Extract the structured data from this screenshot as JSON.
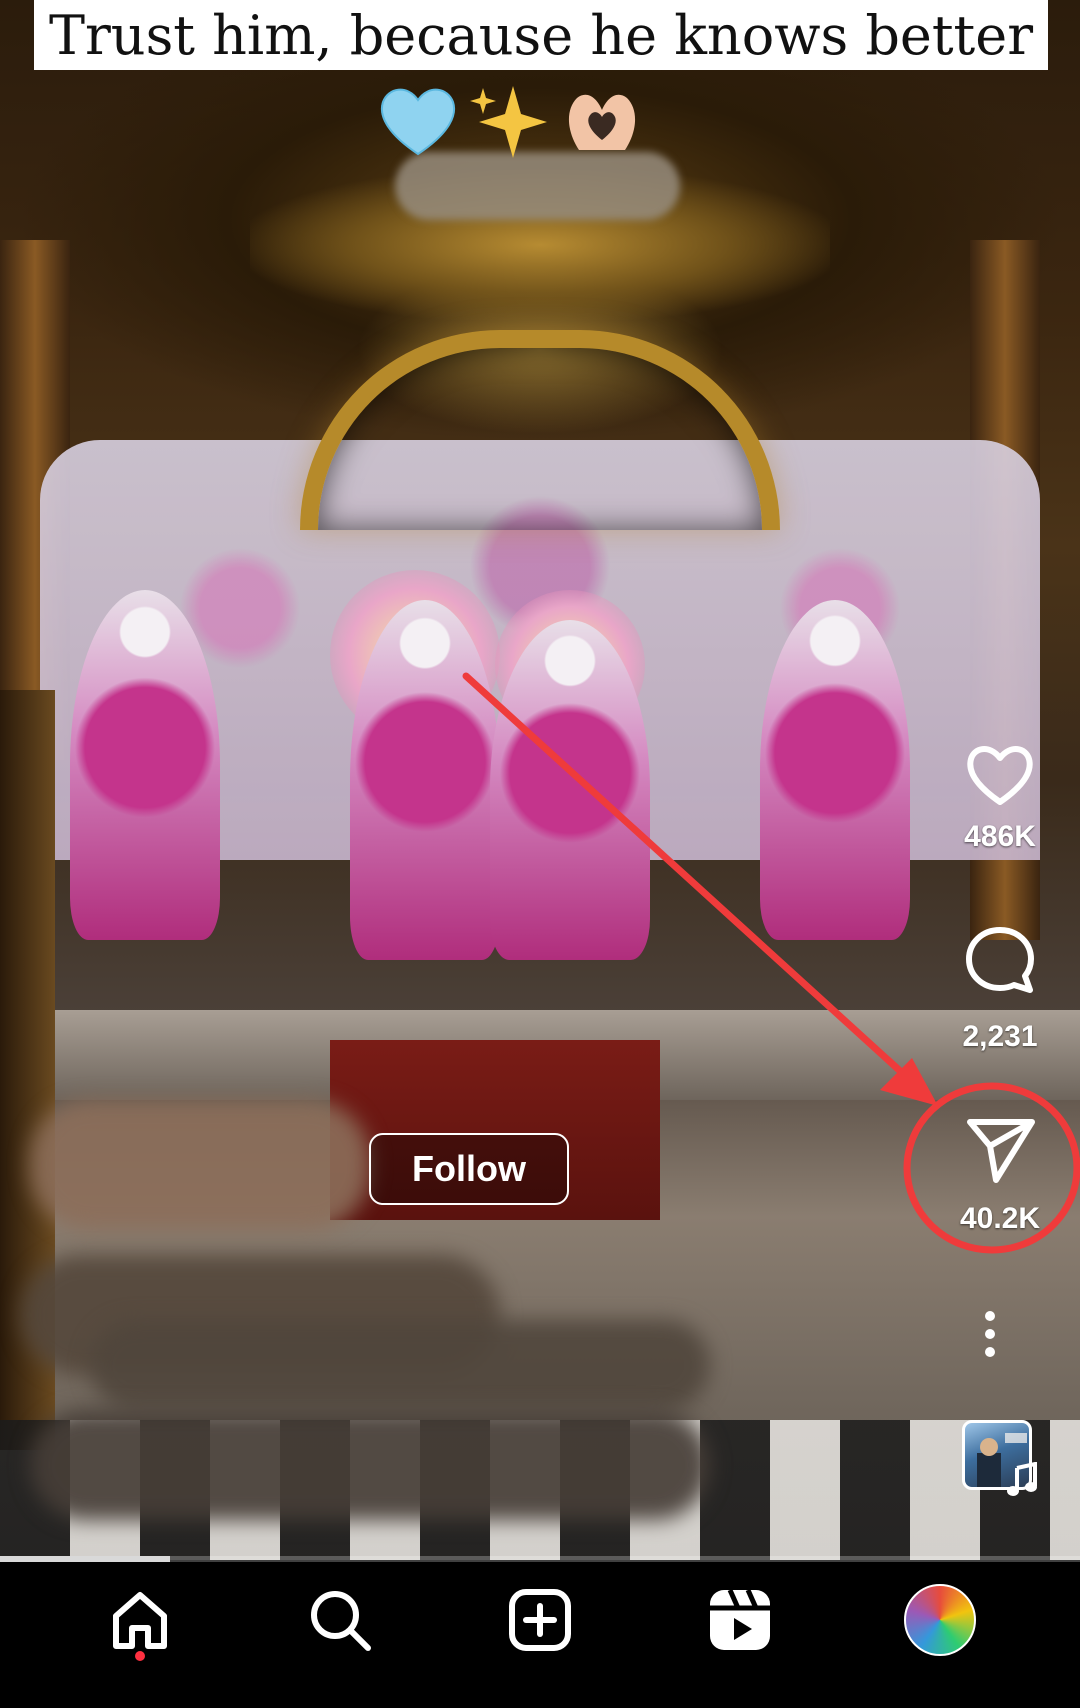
{
  "caption": {
    "text": "Trust him, because he knows better",
    "emojis": [
      "light-blue-heart",
      "sparkles",
      "heart-hands"
    ]
  },
  "follow_label": "Follow",
  "actions": {
    "like": {
      "icon": "heart-icon",
      "count": "486K"
    },
    "comment": {
      "icon": "comment-icon",
      "count": "2,231"
    },
    "share": {
      "icon": "send-icon",
      "count": "40.2K"
    },
    "more": {
      "icon": "more-vertical-icon"
    },
    "audio": {
      "icon": "music-note-icon"
    }
  },
  "progress": {
    "fraction": 0.157
  },
  "nav": [
    {
      "name": "home",
      "icon": "home-icon",
      "active": true
    },
    {
      "name": "search",
      "icon": "search-icon"
    },
    {
      "name": "create",
      "icon": "add-post-icon"
    },
    {
      "name": "reels",
      "icon": "reels-icon"
    },
    {
      "name": "profile",
      "icon": "avatar"
    }
  ],
  "colors": {
    "annotation": "#ef3b3b",
    "notification_dot": "#ff3040",
    "nav_background": "#000000"
  }
}
